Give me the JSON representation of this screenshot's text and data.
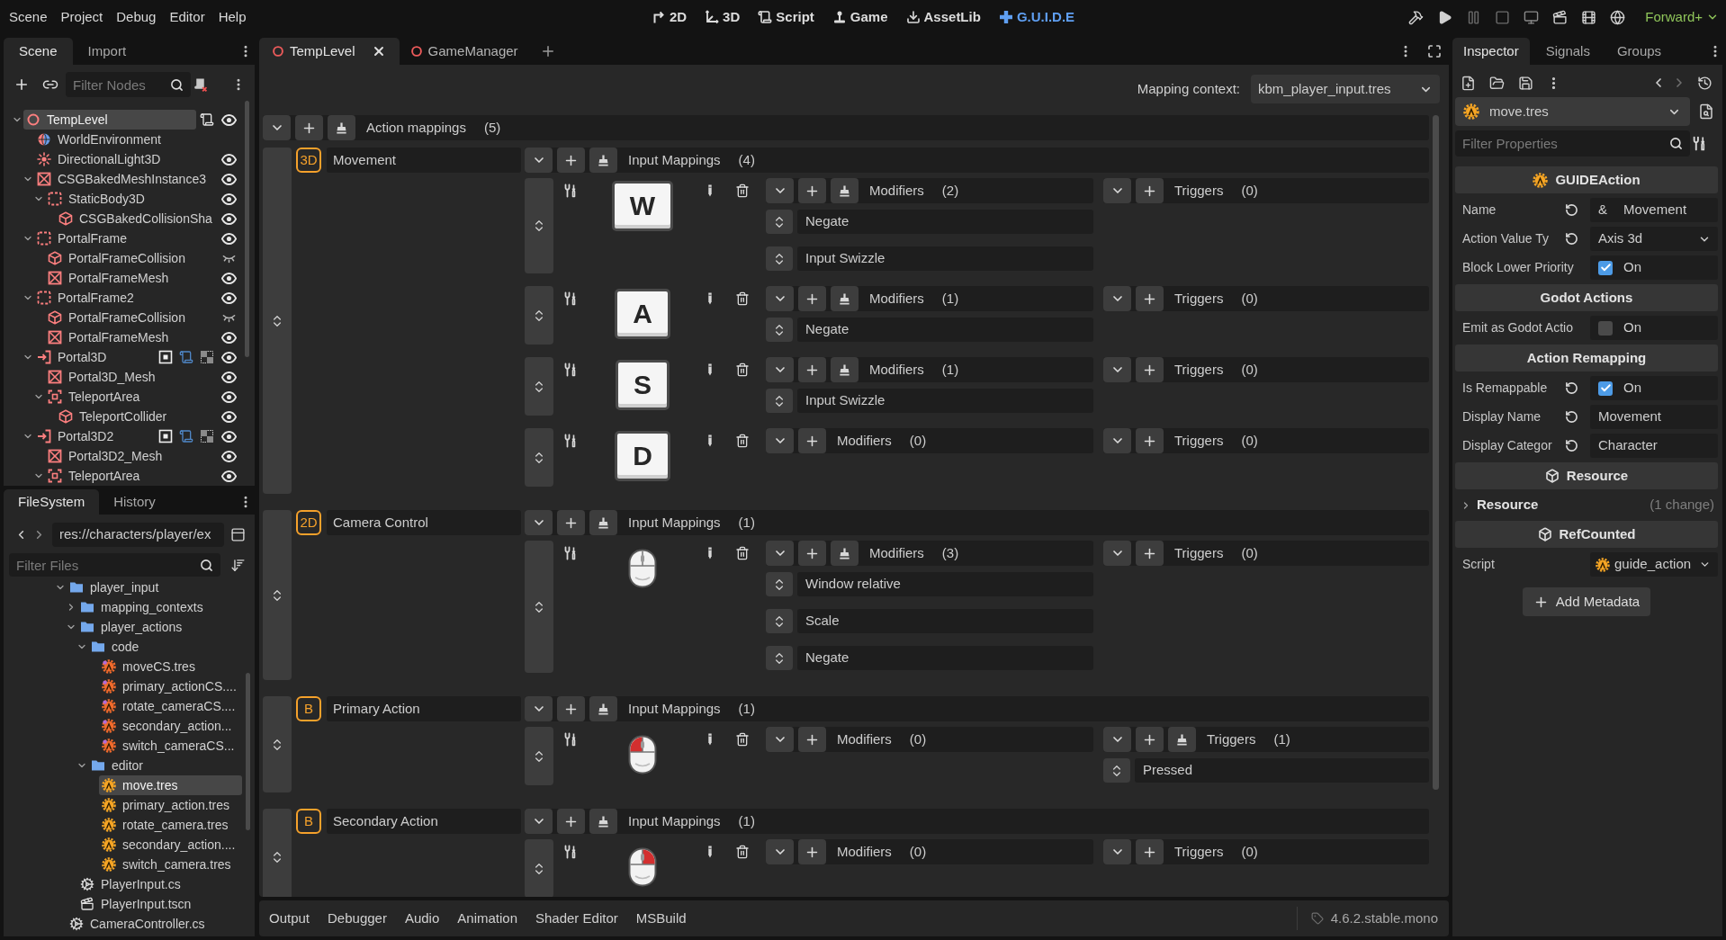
{
  "menu_bar": {
    "menus": [
      "Scene",
      "Project",
      "Debug",
      "Editor",
      "Help"
    ],
    "main_screens": [
      {
        "label": "2D",
        "kind": "canvas",
        "selected": false
      },
      {
        "label": "3D",
        "kind": "spatial",
        "selected": false
      },
      {
        "label": "Script",
        "kind": "script",
        "selected": false
      },
      {
        "label": "Game",
        "kind": "game",
        "selected": false
      },
      {
        "label": "AssetLib",
        "kind": "assetlib",
        "selected": false
      },
      {
        "label": "G.U.I.D.E",
        "kind": "plugin",
        "selected": true
      }
    ],
    "renderer": "Forward+"
  },
  "scene_dock": {
    "tabs": [
      {
        "label": "Scene",
        "selected": true
      },
      {
        "label": "Import",
        "selected": false
      }
    ],
    "filter": {
      "placeholder": "Filter Nodes"
    },
    "tree": [
      {
        "name": "TempLevel",
        "kind": "node3d",
        "selected": true,
        "expanded": true,
        "visible": true,
        "badges": [
          {
            "kind": "script"
          }
        ],
        "children": [
          {
            "name": "WorldEnvironment",
            "kind": "environment",
            "selected": false
          },
          {
            "name": "DirectionalLight3D",
            "kind": "light",
            "selected": false,
            "visible": true
          },
          {
            "name": "CSGBakedMeshInstance3",
            "kind": "mesh",
            "selected": false,
            "expanded": true,
            "visible": true,
            "children": [
              {
                "name": "StaticBody3D",
                "kind": "body",
                "selected": false,
                "expanded": true,
                "visible": true,
                "children": [
                  {
                    "name": "CSGBakedCollisionSha",
                    "kind": "collision",
                    "selected": false,
                    "visible": true
                  }
                ]
              }
            ]
          },
          {
            "name": "PortalFrame",
            "kind": "body",
            "selected": false,
            "expanded": true,
            "visible": true,
            "children": [
              {
                "name": "PortalFrameCollision",
                "kind": "collision",
                "selected": false,
                "visible": false
              },
              {
                "name": "PortalFrameMesh",
                "kind": "mesh",
                "selected": false,
                "visible": true
              }
            ]
          },
          {
            "name": "PortalFrame2",
            "kind": "body",
            "selected": false,
            "expanded": true,
            "visible": true,
            "children": [
              {
                "name": "PortalFrameCollision",
                "kind": "collision",
                "selected": false,
                "visible": false
              },
              {
                "name": "PortalFrameMesh",
                "kind": "mesh",
                "selected": false,
                "visible": true
              }
            ]
          },
          {
            "name": "Portal3D",
            "kind": "portal",
            "selected": false,
            "expanded": true,
            "visible": true,
            "badges": [
              {
                "kind": "group"
              },
              {
                "kind": "linked_script"
              },
              {
                "kind": "checker"
              }
            ],
            "children": [
              {
                "name": "Portal3D_Mesh",
                "kind": "mesh",
                "selected": false,
                "visible": true
              },
              {
                "name": "TeleportArea",
                "kind": "area",
                "selected": false,
                "expanded": true,
                "visible": true,
                "children": [
                  {
                    "name": "TeleportCollider",
                    "kind": "collision",
                    "selected": false,
                    "visible": true
                  }
                ]
              }
            ]
          },
          {
            "name": "Portal3D2",
            "kind": "portal",
            "selected": false,
            "expanded": true,
            "visible": true,
            "badges": [
              {
                "kind": "group"
              },
              {
                "kind": "linked_script"
              },
              {
                "kind": "checker"
              }
            ],
            "children": [
              {
                "name": "Portal3D2_Mesh",
                "kind": "mesh",
                "selected": false,
                "visible": true
              },
              {
                "name": "TeleportArea",
                "kind": "area",
                "selected": false,
                "expanded": true,
                "visible": true
              }
            ]
          }
        ]
      }
    ]
  },
  "filesystem_dock": {
    "tabs": [
      {
        "label": "FileSystem",
        "selected": true
      },
      {
        "label": "History",
        "selected": false
      }
    ],
    "path": "res://characters/player/ex",
    "filter": {
      "placeholder": "Filter Files"
    },
    "tree": [
      {
        "name": "player_input",
        "kind": "folder",
        "selected": false,
        "expanded": true,
        "children": [
          {
            "name": "mapping_contexts",
            "kind": "folder",
            "selected": false,
            "expanded": false
          },
          {
            "name": "player_actions",
            "kind": "folder",
            "selected": false,
            "expanded": true,
            "children": [
              {
                "name": "code",
                "kind": "folder",
                "selected": false,
                "expanded": true,
                "children": [
                  {
                    "name": "moveCS.tres",
                    "kind": "action_resource_cs",
                    "selected": false
                  },
                  {
                    "name": "primary_actionCS....",
                    "kind": "action_resource_cs",
                    "selected": false
                  },
                  {
                    "name": "rotate_cameraCS....",
                    "kind": "action_resource_cs",
                    "selected": false
                  },
                  {
                    "name": "secondary_action...",
                    "kind": "action_resource_cs",
                    "selected": false
                  },
                  {
                    "name": "switch_cameraCS...",
                    "kind": "action_resource_cs",
                    "selected": false
                  }
                ]
              },
              {
                "name": "editor",
                "kind": "folder",
                "selected": false,
                "expanded": true,
                "children": [
                  {
                    "name": "move.tres",
                    "kind": "action_resource",
                    "selected": true
                  },
                  {
                    "name": "primary_action.tres",
                    "kind": "action_resource",
                    "selected": false
                  },
                  {
                    "name": "rotate_camera.tres",
                    "kind": "action_resource",
                    "selected": false
                  },
                  {
                    "name": "secondary_action....",
                    "kind": "action_resource",
                    "selected": false
                  },
                  {
                    "name": "switch_camera.tres",
                    "kind": "action_resource",
                    "selected": false
                  }
                ]
              }
            ]
          },
          {
            "name": "PlayerInput.cs",
            "kind": "csharp_script",
            "selected": false
          },
          {
            "name": "PlayerInput.tscn",
            "kind": "scene",
            "selected": false
          }
        ]
      },
      {
        "name": "CameraController.cs",
        "kind": "csharp_script",
        "selected": false
      }
    ]
  },
  "editor_tabs": [
    {
      "label": "TempLevel",
      "selected": true
    },
    {
      "label": "GameManager",
      "selected": false
    }
  ],
  "guide_editor": {
    "mapping_context": {
      "label": "Mapping context:",
      "value": "kbm_player_input.tres"
    },
    "action_mappings": {
      "label": "Action mappings",
      "count": "(5)"
    },
    "actions": [
      {
        "badge": "3D",
        "name": "Movement",
        "mappings_label": "Input Mappings",
        "mappings_count": "(4)",
        "inputs": [
          {
            "kind": "key",
            "key": "W",
            "modifiers": {
              "label": "Modifiers",
              "count": "(2)",
              "items": [
                "Negate",
                "Input Swizzle"
              ]
            },
            "triggers": {
              "label": "Triggers",
              "count": "(0)"
            }
          },
          {
            "kind": "key",
            "key": "A",
            "modifiers": {
              "label": "Modifiers",
              "count": "(1)",
              "items": [
                "Negate"
              ]
            },
            "triggers": {
              "label": "Triggers",
              "count": "(0)"
            }
          },
          {
            "kind": "key",
            "key": "S",
            "modifiers": {
              "label": "Modifiers",
              "count": "(1)",
              "items": [
                "Input Swizzle"
              ]
            },
            "triggers": {
              "label": "Triggers",
              "count": "(0)"
            }
          },
          {
            "kind": "key",
            "key": "D",
            "modifiers": {
              "label": "Modifiers",
              "count": "(0)"
            },
            "triggers": {
              "label": "Triggers",
              "count": "(0)"
            }
          }
        ]
      },
      {
        "badge": "2D",
        "name": "Camera Control",
        "mappings_label": "Input Mappings",
        "mappings_count": "(1)",
        "inputs": [
          {
            "kind": "mouse",
            "left_pressed": false,
            "right_pressed": false,
            "modifiers": {
              "label": "Modifiers",
              "count": "(3)",
              "items": [
                "Window relative",
                "Scale",
                "Negate"
              ]
            },
            "triggers": {
              "label": "Triggers",
              "count": "(0)"
            }
          }
        ]
      },
      {
        "badge": "B",
        "name": "Primary Action",
        "mappings_label": "Input Mappings",
        "mappings_count": "(1)",
        "inputs": [
          {
            "kind": "mouse",
            "left_pressed": true,
            "right_pressed": false,
            "modifiers": {
              "label": "Modifiers",
              "count": "(0)"
            },
            "triggers": {
              "label": "Triggers",
              "count": "(1)",
              "items": [
                "Pressed"
              ]
            }
          }
        ]
      },
      {
        "badge": "B",
        "name": "Secondary Action",
        "mappings_label": "Input Mappings",
        "mappings_count": "(1)",
        "inputs": [
          {
            "kind": "mouse",
            "left_pressed": false,
            "right_pressed": true,
            "modifiers": {
              "label": "Modifiers",
              "count": "(0)"
            },
            "triggers": {
              "label": "Triggers",
              "count": "(0)"
            }
          }
        ]
      }
    ]
  },
  "bottom_panel": {
    "tabs": [
      "Output",
      "Debugger",
      "Audio",
      "Animation",
      "Shader Editor",
      "MSBuild"
    ],
    "version": "4.6.2.stable.mono"
  },
  "inspector": {
    "tabs": [
      {
        "label": "Inspector",
        "selected": true
      },
      {
        "label": "Signals",
        "selected": false
      },
      {
        "label": "Groups",
        "selected": false
      }
    ],
    "resource": "move.tres",
    "filter": {
      "placeholder": "Filter Properties"
    },
    "properties": [
      {
        "kind": "script_class",
        "label": "GUIDEAction"
      },
      {
        "kind": "text",
        "label": "Name",
        "revertable": true,
        "prefix": "&",
        "value": "Movement"
      },
      {
        "kind": "dropdown",
        "label": "Action Value Ty",
        "revertable": true,
        "value": "Axis 3d"
      },
      {
        "kind": "checkbox",
        "label": "Block Lower Priority",
        "revertable": false,
        "checked": true,
        "value": "On"
      },
      {
        "kind": "group",
        "label": "Godot Actions"
      },
      {
        "kind": "checkbox",
        "label": "Emit as Godot Actio",
        "revertable": false,
        "checked": false,
        "value": "On"
      },
      {
        "kind": "group",
        "label": "Action Remapping"
      },
      {
        "kind": "checkbox",
        "label": "Is Remappable",
        "revertable": true,
        "checked": true,
        "value": "On"
      },
      {
        "kind": "text",
        "label": "Display Name",
        "revertable": true,
        "value": "Movement"
      },
      {
        "kind": "text",
        "label": "Display Categor",
        "revertable": true,
        "value": "Character"
      },
      {
        "kind": "class",
        "label": "Resource"
      },
      {
        "kind": "subgroup",
        "label": "Resource",
        "note": "(1 change)",
        "expanded": false
      },
      {
        "kind": "class",
        "label": "RefCounted"
      },
      {
        "kind": "script",
        "label": "Script",
        "revertable": false,
        "value": "guide_action"
      }
    ],
    "add_metadata": "Add Metadata"
  }
}
